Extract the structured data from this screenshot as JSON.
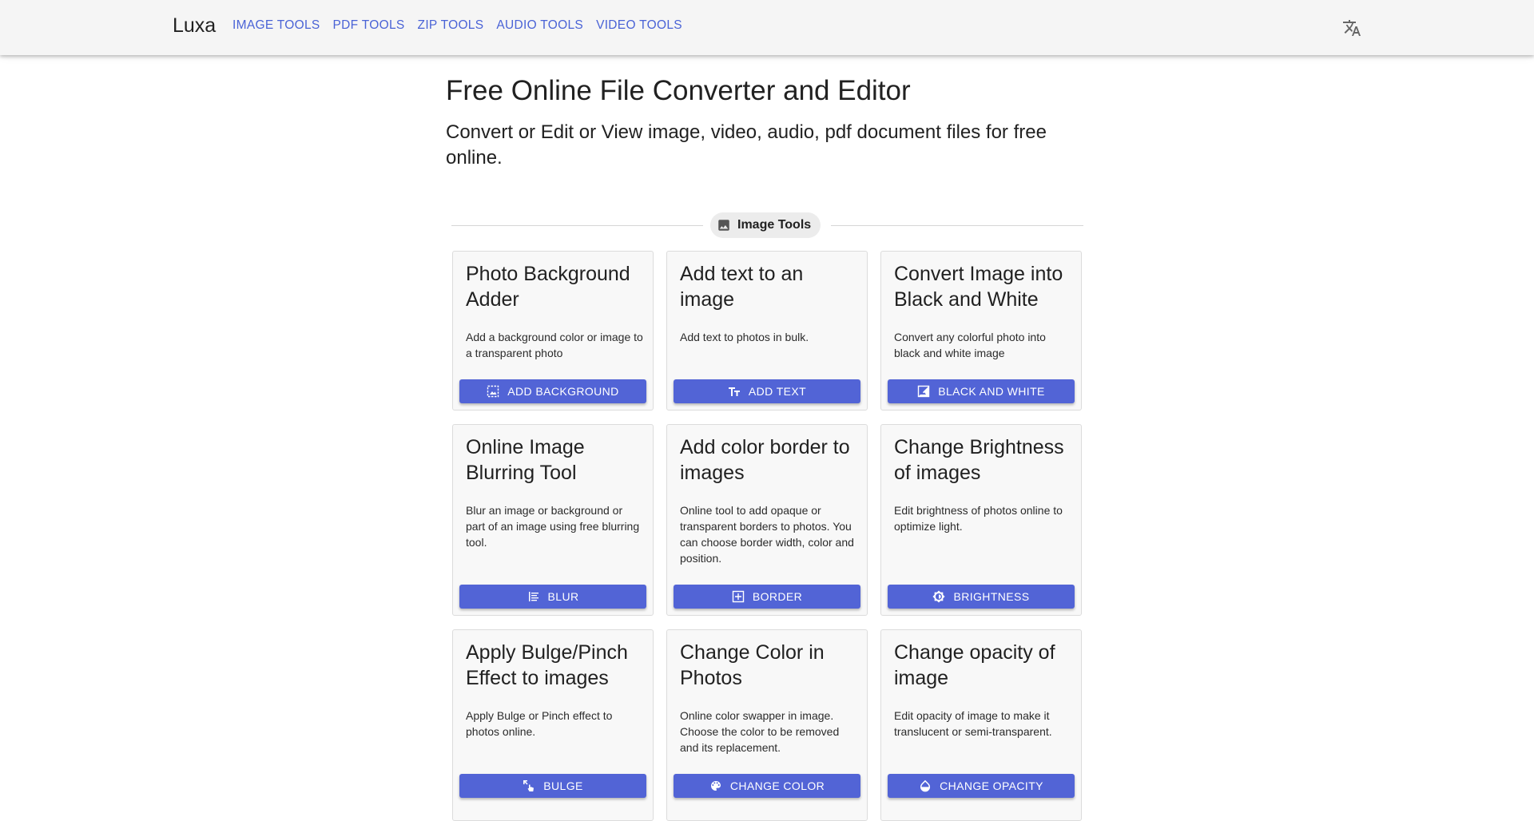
{
  "app": {
    "brand": "Luxa"
  },
  "nav": [
    {
      "label": "IMAGE TOOLS"
    },
    {
      "label": "PDF TOOLS"
    },
    {
      "label": "ZIP TOOLS"
    },
    {
      "label": "AUDIO TOOLS"
    },
    {
      "label": "VIDEO TOOLS"
    }
  ],
  "header": {
    "language_icon": "translate-icon"
  },
  "page": {
    "title": "Free Online File Converter and Editor",
    "subtitle": "Convert or Edit or View image, video, audio, pdf document files for free online."
  },
  "section": {
    "label": "Image Tools",
    "icon": "image-icon"
  },
  "theme": {
    "primary": "#5264d6",
    "link": "#4a63d6",
    "appbar": "#f5f5f5",
    "card": "#f8f8f8"
  },
  "cards": [
    {
      "title": "Photo Background Adder",
      "description": "Add a background color or image to a transparent photo",
      "button": "ADD BACKGROUND",
      "icon": "image-frame-icon"
    },
    {
      "title": "Add text to an image",
      "description": "Add text to photos in bulk.",
      "button": "ADD TEXT",
      "icon": "text-format-icon"
    },
    {
      "title": "Convert Image into Black and White",
      "description": "Convert any colorful photo into black and white image",
      "button": "BLACK AND WHITE",
      "icon": "black-white-icon"
    },
    {
      "title": "Online Image Blurring Tool",
      "description": "Blur an image or background or part of an image using free blurring tool.",
      "button": "BLUR",
      "icon": "blur-icon"
    },
    {
      "title": "Add color border to images",
      "description": "Online tool to add opaque or transparent borders to photos. You can choose border width, color and position.",
      "button": "BORDER",
      "icon": "border-icon"
    },
    {
      "title": "Change Brightness of images",
      "description": "Edit brightness of photos online to optimize light.",
      "button": "BRIGHTNESS",
      "icon": "brightness-icon"
    },
    {
      "title": "Apply Bulge/Pinch Effect to images",
      "description": "Apply Bulge or Pinch effect to photos online.",
      "button": "BULGE",
      "icon": "pinch-icon"
    },
    {
      "title": "Change Color in Photos",
      "description": "Online color swapper in image. Choose the color to be removed and its replacement.",
      "button": "CHANGE COLOR",
      "icon": "palette-icon"
    },
    {
      "title": "Change opacity of image",
      "description": "Edit opacity of image to make it translucent or semi-transparent.",
      "button": "CHANGE OPACITY",
      "icon": "opacity-icon"
    }
  ]
}
